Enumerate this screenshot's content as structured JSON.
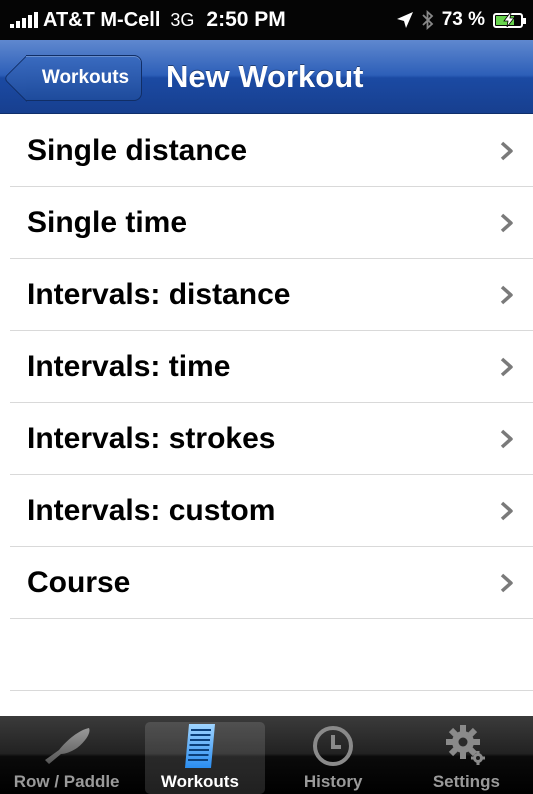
{
  "status_bar": {
    "carrier": "AT&T M-Cell",
    "network": "3G",
    "time": "2:50 PM",
    "battery_percent": "73 %",
    "battery_level": 0.73
  },
  "nav": {
    "back_label": "Workouts",
    "title": "New Workout"
  },
  "list": {
    "items": [
      {
        "label": "Single distance"
      },
      {
        "label": "Single time"
      },
      {
        "label": "Intervals: distance"
      },
      {
        "label": "Intervals: time"
      },
      {
        "label": "Intervals: strokes"
      },
      {
        "label": "Intervals: custom"
      },
      {
        "label": "Course"
      }
    ]
  },
  "tabs": [
    {
      "label": "Row / Paddle",
      "icon": "oar-icon",
      "active": false
    },
    {
      "label": "Workouts",
      "icon": "workout-list-icon",
      "active": true
    },
    {
      "label": "History",
      "icon": "clock-icon",
      "active": false
    },
    {
      "label": "Settings",
      "icon": "gear-icon",
      "active": false
    }
  ],
  "colors": {
    "nav_blue": "#1b4aa3",
    "workouts_icon_blue": "#4aa3ff"
  }
}
